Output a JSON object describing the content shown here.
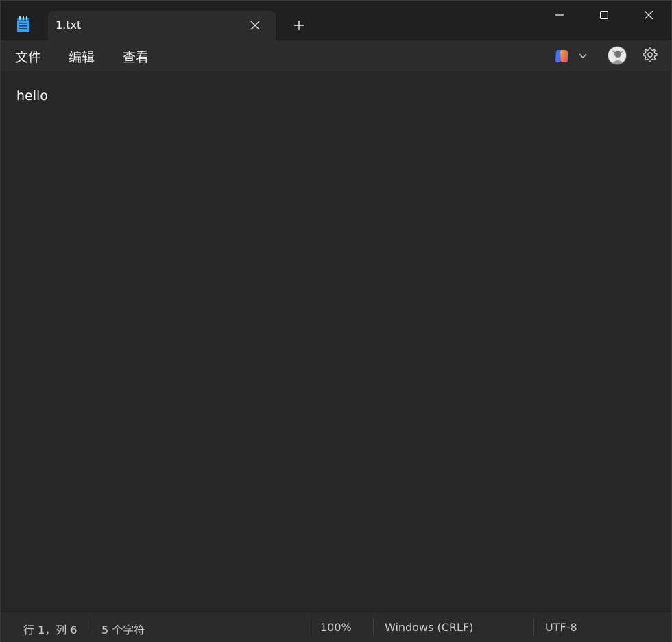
{
  "tab": {
    "title": "1.txt"
  },
  "menu": {
    "file": "文件",
    "edit": "编辑",
    "view": "查看"
  },
  "editor": {
    "content": "hello"
  },
  "status": {
    "position": "行 1，列 6",
    "char_count": "5 个字符",
    "zoom": "100%",
    "line_ending": "Windows (CRLF)",
    "encoding": "UTF-8"
  },
  "icons": {
    "app": "notepad-icon",
    "tab_close": "close-icon",
    "new_tab": "plus-icon",
    "minimize": "minimize-icon",
    "maximize": "maximize-icon",
    "close": "close-icon",
    "copilot": "copilot-icon",
    "chevron": "chevron-down-icon",
    "avatar": "avatar",
    "settings": "gear-icon"
  },
  "colors": {
    "titlebar_bg": "#202020",
    "menubar_bg": "#2c2c2c",
    "editor_bg": "#272727",
    "text": "#ffffff"
  }
}
